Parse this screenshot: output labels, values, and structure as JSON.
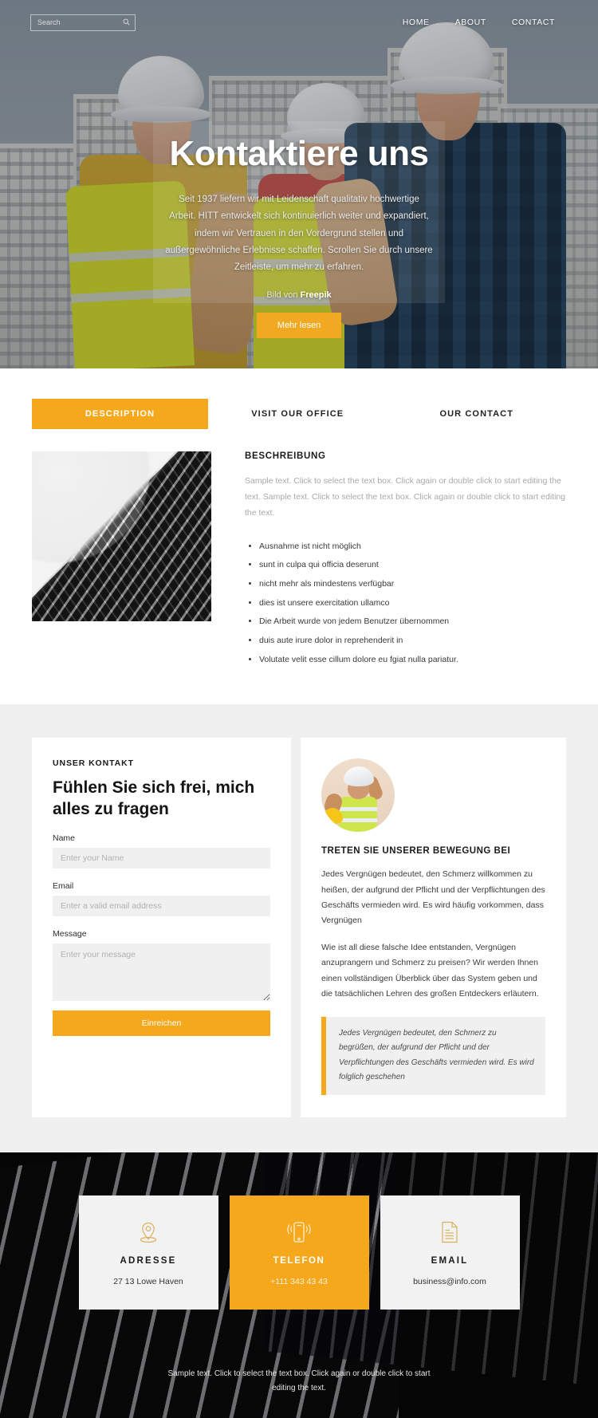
{
  "nav": {
    "search_placeholder": "Search",
    "search_value": "",
    "links": [
      {
        "label": "HOME"
      },
      {
        "label": "ABOUT"
      },
      {
        "label": "CONTACT"
      }
    ]
  },
  "hero": {
    "title": "Kontaktiere uns",
    "subtitle": "Seit 1937 liefern wir mit Leidenschaft qualitativ hochwertige Arbeit. HITT entwickelt sich kontinuierlich weiter und expandiert, indem wir Vertrauen in den Vordergrund stellen und außergewöhnliche Erlebnisse schaffen. Scrollen Sie durch unsere Zeitleiste, um mehr zu erfahren.",
    "credit_prefix": "Bild von ",
    "credit_source": "Freepik",
    "button_label": "Mehr lesen"
  },
  "tabs": {
    "items": [
      {
        "label": "DESCRIPTION",
        "active": true
      },
      {
        "label": "VISIT OUR OFFICE",
        "active": false
      },
      {
        "label": "OUR CONTACT",
        "active": false
      }
    ]
  },
  "description": {
    "heading": "BESCHREIBUNG",
    "paragraph": "Sample text. Click to select the text box. Click again or double click to start editing the text. Sample text. Click to select the text box. Click again or double click to start editing the text.",
    "bullets": [
      "Ausnahme ist nicht möglich",
      "sunt in culpa qui officia deserunt",
      "nicht mehr als mindestens verfügbar",
      "dies ist unsere exercitation ullamco",
      "Die Arbeit wurde von jedem Benutzer übernommen",
      "duis aute irure dolor in reprehenderit in",
      "Volutate velit esse cillum dolore eu fgiat nulla pariatur."
    ]
  },
  "contact_form": {
    "kicker": "UNSER KONTAKT",
    "title": "Fühlen Sie sich frei, mich alles zu fragen",
    "fields": [
      {
        "label": "Name",
        "placeholder": "Enter your Name",
        "value": ""
      },
      {
        "label": "Email",
        "placeholder": "Enter a valid email address",
        "value": ""
      },
      {
        "label": "Message",
        "placeholder": "Enter your message",
        "value": ""
      }
    ],
    "submit_label": "Einreichen"
  },
  "join_card": {
    "heading": "TRETEN SIE UNSERER BEWEGUNG BEI",
    "paragraph_1": "Jedes Vergnügen bedeutet, den Schmerz willkommen zu heißen, der aufgrund der Pflicht und der Verpflichtungen des Geschäfts vermieden wird. Es wird häufig vorkommen, dass Vergnügen",
    "paragraph_2": "Wie ist all diese falsche Idee entstanden, Vergnügen anzuprangern und Schmerz zu preisen? Wir werden Ihnen einen vollständigen Überblick über das System geben und die tatsächlichen Lehren des großen Entdeckers erläutern.",
    "quote": "Jedes Vergnügen bedeutet, den Schmerz zu begrüßen, der aufgrund der Pflicht und der Verpflichtungen des Geschäfts vermieden wird. Es wird folglich geschehen"
  },
  "info_cards": [
    {
      "icon": "map-pin-icon",
      "title": "ADRESSE",
      "value": "27 13 Lowe Haven",
      "accent": false
    },
    {
      "icon": "ringing-phone-icon",
      "title": "TELEFON",
      "value": "+111 343 43 43",
      "accent": true
    },
    {
      "icon": "document-icon",
      "title": "EMAIL",
      "value": "business@info.com",
      "accent": false
    }
  ],
  "footer": {
    "note": "Sample text. Click to select the text box. Click again or double click to start editing the text."
  },
  "colors": {
    "accent": "#f5a81c",
    "accent_button": "#f2a922",
    "dark": "#060606",
    "light_gray": "#f0f0f0"
  }
}
